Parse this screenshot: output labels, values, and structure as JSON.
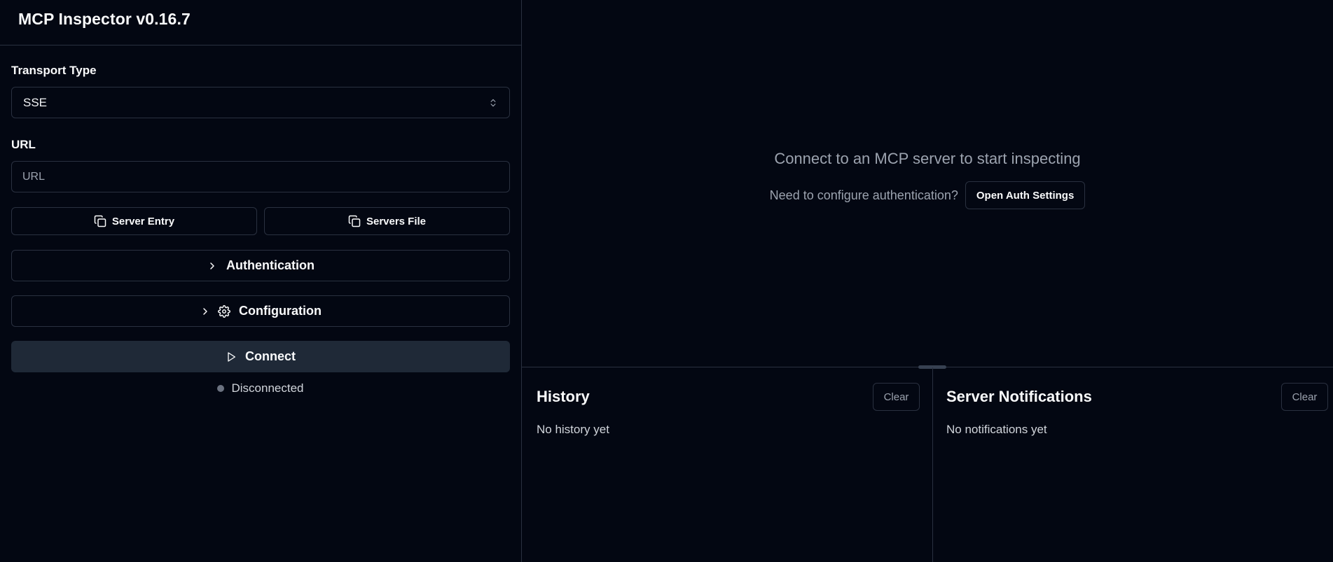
{
  "app": {
    "title": "MCP Inspector v0.16.7"
  },
  "sidebar": {
    "transport_label": "Transport Type",
    "transport_value": "SSE",
    "url_label": "URL",
    "url_placeholder": "URL",
    "url_value": "",
    "server_entry_label": "Server Entry",
    "servers_file_label": "Servers File",
    "authentication_label": "Authentication",
    "configuration_label": "Configuration",
    "connect_label": "Connect",
    "status_text": "Disconnected",
    "status_color": "#6b7280"
  },
  "main": {
    "prompt": "Connect to an MCP server to start inspecting",
    "auth_question": "Need to configure authentication?",
    "auth_button": "Open Auth Settings"
  },
  "history": {
    "title": "History",
    "clear_label": "Clear",
    "empty_text": "No history yet"
  },
  "notifications": {
    "title": "Server Notifications",
    "clear_label": "Clear",
    "empty_text": "No notifications yet"
  },
  "colors": {
    "background": "#030712",
    "border": "#2a3140",
    "connect_button": "#1f2937"
  },
  "icons": {
    "select": "chevrons-up-down-icon",
    "copy": "copy-icon",
    "chevron": "chevron-right-icon",
    "settings": "gear-icon",
    "play": "play-icon"
  }
}
